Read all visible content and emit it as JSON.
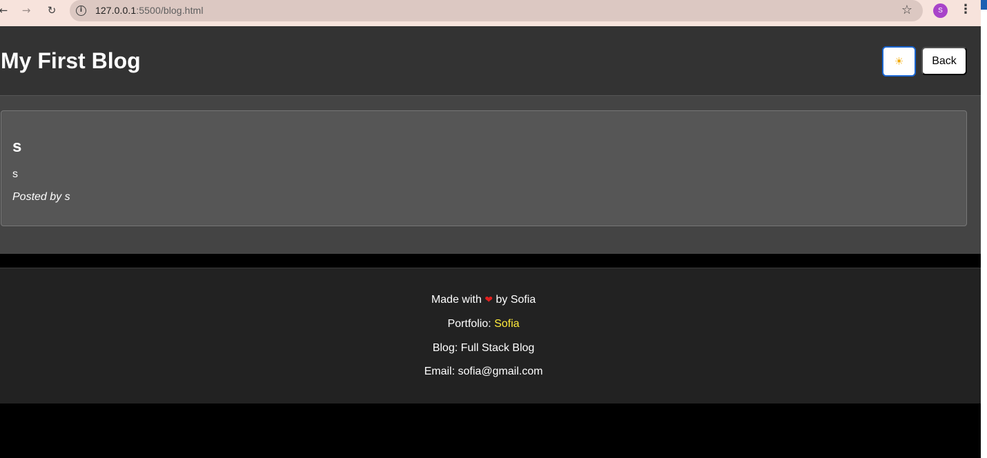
{
  "browser": {
    "url_host": "127.0.0.1",
    "url_path": ":5500/blog.html",
    "avatar_letter": "S"
  },
  "header": {
    "title": "My First Blog",
    "theme_icon": "sun-icon",
    "back_label": "Back"
  },
  "post": {
    "title": "s",
    "body": "s",
    "author": "Posted by s"
  },
  "footer": {
    "made_prefix": "Made with",
    "made_suffix": "by Sofia",
    "portfolio_label": "Portfolio:",
    "portfolio_link": "Sofia",
    "blog": "Blog: Full Stack Blog",
    "email": "Email: sofia@gmail.com"
  },
  "colors": {
    "header_bg": "#333333",
    "main_bg": "#444444",
    "card_bg": "#565656",
    "footer_bg": "#222222",
    "link": "#ffeb3b",
    "heart": "#e0201f"
  }
}
